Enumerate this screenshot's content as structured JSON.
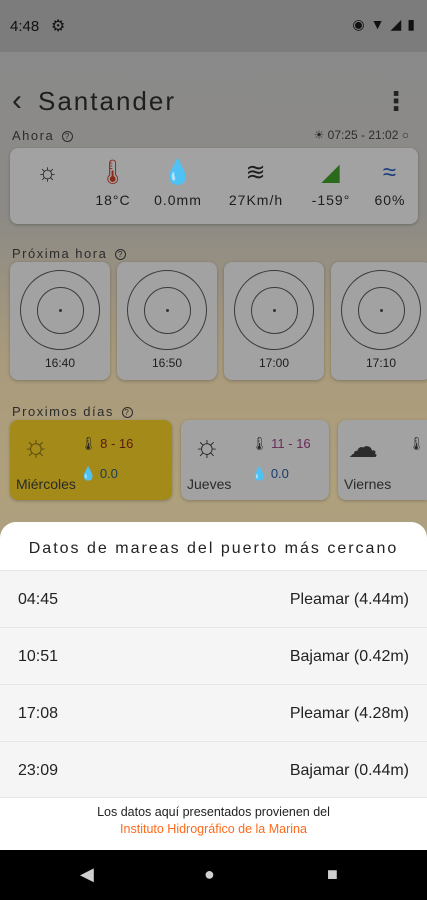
{
  "status_bar": {
    "time": "4:48",
    "icons": [
      "gear-icon",
      "eye-icon",
      "wifi-icon",
      "signal-icon",
      "battery-icon"
    ]
  },
  "header": {
    "city": "Santander"
  },
  "now": {
    "label": "Ahora",
    "sun_times": "07:25 - 21:02",
    "items": [
      {
        "icon": "sun-icon",
        "value": ""
      },
      {
        "icon": "thermometer-icon",
        "value": "18°C"
      },
      {
        "icon": "drop-icon",
        "value": "0.0mm"
      },
      {
        "icon": "wind-icon",
        "value": "27Km/h"
      },
      {
        "icon": "direction-icon",
        "value": "-159°"
      },
      {
        "icon": "waves-icon",
        "value": "60%"
      }
    ]
  },
  "next_hour": {
    "label": "Próxima hora",
    "times": [
      "16:40",
      "16:50",
      "17:00",
      "17:10"
    ]
  },
  "next_days": {
    "label": "Proximos días",
    "days": [
      {
        "name": "Miércoles",
        "temp": "8 - 16",
        "rain": "0.0"
      },
      {
        "name": "Jueves",
        "temp": "11 - 16",
        "rain": "0.0"
      },
      {
        "name": "Viernes",
        "temp": "",
        "rain": ""
      }
    ]
  },
  "tides": {
    "title": "Datos de mareas del puerto más cercano",
    "rows": [
      {
        "time": "04:45",
        "desc": "Pleamar (4.44m)"
      },
      {
        "time": "10:51",
        "desc": "Bajamar (0.42m)"
      },
      {
        "time": "17:08",
        "desc": "Pleamar (4.28m)"
      },
      {
        "time": "23:09",
        "desc": "Bajamar (0.44m)"
      }
    ],
    "source_text": "Los datos aquí presentados provienen del",
    "source_link": "Instituto Hidrográfico de la Marina"
  },
  "colors": {
    "accent": "#ff6a1a",
    "active_day": "#a48a18"
  }
}
